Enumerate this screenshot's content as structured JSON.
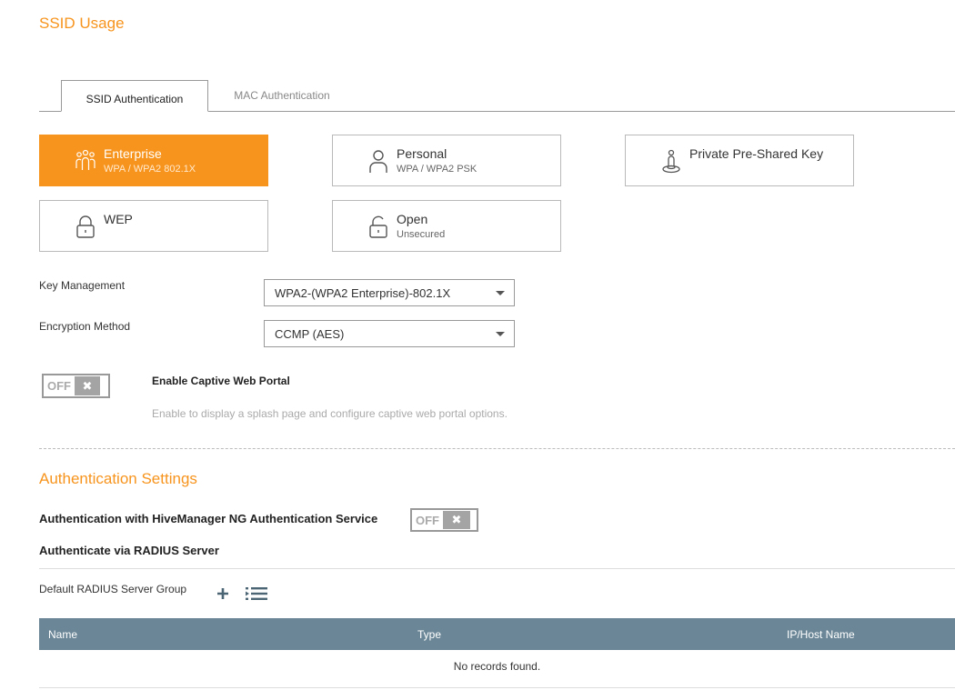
{
  "page": {
    "title": "SSID Usage"
  },
  "tabs": [
    {
      "label": "SSID Authentication",
      "active": true
    },
    {
      "label": "MAC Authentication",
      "active": false
    }
  ],
  "auth_options": [
    {
      "title": "Enterprise",
      "sub": "WPA / WPA2 802.1X",
      "icon": "users-icon",
      "selected": true
    },
    {
      "title": "Personal",
      "sub": "WPA / WPA2 PSK",
      "icon": "user-icon",
      "selected": false
    },
    {
      "title": "Private Pre-Shared Key",
      "sub": "",
      "icon": "key-person-icon",
      "selected": false
    },
    {
      "title": "WEP",
      "sub": "",
      "icon": "lock-icon",
      "selected": false
    },
    {
      "title": "Open",
      "sub": "Unsecured",
      "icon": "unlock-icon",
      "selected": false
    }
  ],
  "key_management": {
    "label": "Key Management",
    "value": "WPA2-(WPA2 Enterprise)-802.1X"
  },
  "encryption": {
    "label": "Encryption Method",
    "value": "CCMP (AES)"
  },
  "captive_portal": {
    "toggle_text": "OFF",
    "knob_icon": "✖",
    "title": "Enable Captive Web Portal",
    "desc": "Enable to display a splash page and configure captive web portal options."
  },
  "auth_settings": {
    "title": "Authentication Settings",
    "hm_label": "Authentication with HiveManager NG Authentication Service",
    "hm_toggle_text": "OFF",
    "hm_knob_icon": "✖",
    "radius_label": "Authenticate via RADIUS Server",
    "group_label": "Default RADIUS Server Group"
  },
  "table": {
    "columns": [
      "Name",
      "Type",
      "IP/Host Name"
    ],
    "empty_text": "No records found."
  },
  "colors": {
    "accent": "#f7941d",
    "table_header": "#6b8797"
  }
}
